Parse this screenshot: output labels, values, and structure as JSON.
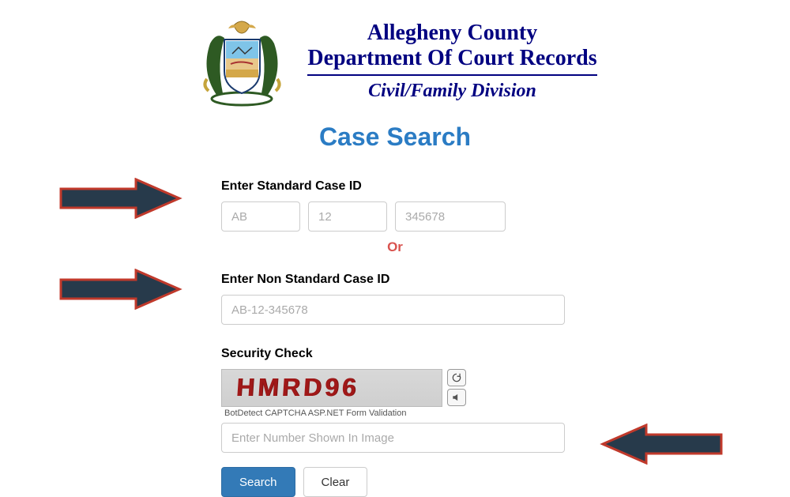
{
  "header": {
    "line1": "Allegheny County",
    "line2": "Department Of Court Records",
    "line3": "Civil/Family Division"
  },
  "page_title": "Case Search",
  "form": {
    "std_label": "Enter Standard Case ID",
    "std_ph_a": "AB",
    "std_ph_b": "12",
    "std_ph_c": "345678",
    "or_text": "Or",
    "nonstd_label": "Enter Non Standard Case ID",
    "nonstd_ph": "AB-12-345678",
    "sec_label": "Security Check",
    "captcha_value": "HMRD96",
    "captcha_caption": "BotDetect CAPTCHA ASP.NET Form Validation",
    "captcha_input_ph": "Enter Number Shown In Image",
    "search_btn": "Search",
    "clear_btn": "Clear"
  },
  "colors": {
    "navy": "#000080",
    "heading_blue": "#2b7cc4",
    "or_red": "#d9534f",
    "arrow_fill": "#273a4b",
    "arrow_stroke": "#c0392b",
    "captcha_ink": "#a01818"
  }
}
